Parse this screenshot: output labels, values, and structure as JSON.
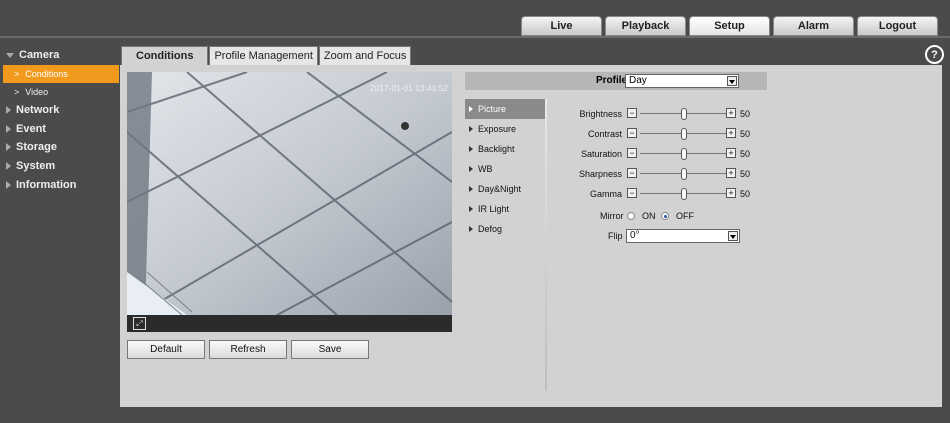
{
  "topnav": [
    "Live",
    "Playback",
    "Setup",
    "Alarm",
    "Logout"
  ],
  "topnav_active": "Setup",
  "sidebar": {
    "camera": "Camera",
    "camera_sub": [
      "Conditions",
      "Video"
    ],
    "sections": [
      "Network",
      "Event",
      "Storage",
      "System",
      "Information"
    ]
  },
  "subtabs": [
    "Conditions",
    "Profile Management",
    "Zoom and Focus"
  ],
  "help_glyph": "?",
  "video": {
    "timestamp": "2017-01-01 13:41:52",
    "fullscreen_glyph": "⤢"
  },
  "buttons": {
    "default": "Default",
    "refresh": "Refresh",
    "save": "Save"
  },
  "profile": {
    "label": "Profile",
    "value": "Day"
  },
  "menu": [
    "Picture",
    "Exposure",
    "Backlight",
    "WB",
    "Day&Night",
    "IR Light",
    "Defog"
  ],
  "menu_active": "Picture",
  "sliders": [
    {
      "label": "Brightness",
      "value": "50",
      "level": 50
    },
    {
      "label": "Contrast",
      "value": "50",
      "level": 50
    },
    {
      "label": "Saturation",
      "value": "50",
      "level": 50
    },
    {
      "label": "Sharpness",
      "value": "50",
      "level": 50
    },
    {
      "label": "Gamma",
      "value": "50",
      "level": 50
    }
  ],
  "mirror": {
    "label": "Mirror",
    "on": "ON",
    "off": "OFF",
    "selected": "OFF"
  },
  "flip": {
    "label": "Flip",
    "value": "0°"
  },
  "colors": {
    "accent": "#f29a1e",
    "background": "#4b4b4b",
    "panel": "#d2d2d2"
  }
}
